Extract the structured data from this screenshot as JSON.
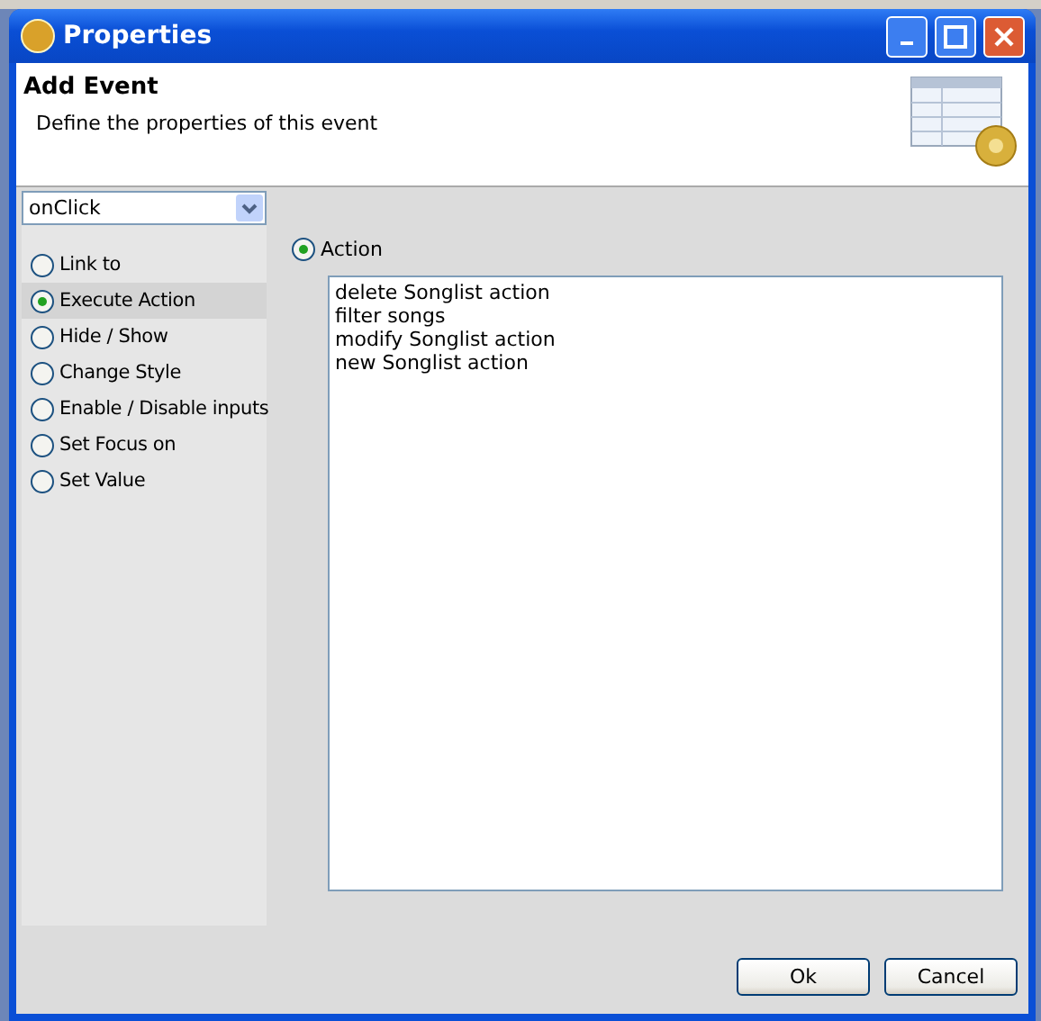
{
  "window": {
    "title": "Properties"
  },
  "header": {
    "title": "Add Event",
    "description": "Define the properties of this event"
  },
  "event_select": {
    "value": "onClick"
  },
  "behaviors": [
    {
      "label": "Link to",
      "selected": false
    },
    {
      "label": "Execute Action",
      "selected": true
    },
    {
      "label": "Hide / Show",
      "selected": false
    },
    {
      "label": "Change Style",
      "selected": false
    },
    {
      "label": "Enable / Disable inputs",
      "selected": false
    },
    {
      "label": "Set Focus on",
      "selected": false
    },
    {
      "label": "Set Value",
      "selected": false
    }
  ],
  "action_option": {
    "label": "Action",
    "selected": true
  },
  "actions": [
    "delete Songlist action",
    "filter songs",
    "modify Songlist action",
    "new Songlist action"
  ],
  "buttons": [
    "Ok",
    "Cancel"
  ]
}
